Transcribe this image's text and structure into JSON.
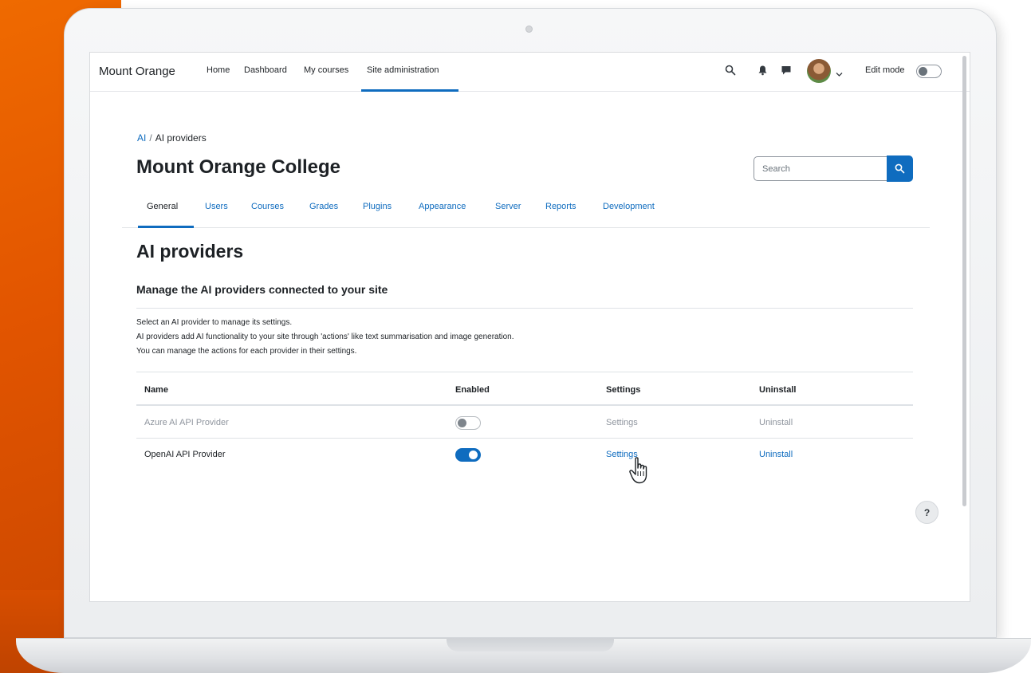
{
  "navbar": {
    "brand": "Mount Orange",
    "items": [
      "Home",
      "Dashboard",
      "My courses",
      "Site administration"
    ],
    "edit_mode_label": "Edit mode"
  },
  "breadcrumb": {
    "root": "AI",
    "separator": "/",
    "current": "AI providers"
  },
  "site_title": "Mount Orange College",
  "search": {
    "placeholder": "Search"
  },
  "tabs": [
    "General",
    "Users",
    "Courses",
    "Grades",
    "Plugins",
    "Appearance",
    "Server",
    "Reports",
    "Development"
  ],
  "page": {
    "heading": "AI providers",
    "subheading": "Manage the AI providers connected to your site",
    "description": [
      "Select an AI provider to manage its settings.",
      "AI providers add AI functionality to your site through 'actions' like text summarisation and image generation.",
      "You can manage the actions for each provider in their settings."
    ]
  },
  "table": {
    "headers": [
      "Name",
      "Enabled",
      "Settings",
      "Uninstall"
    ],
    "rows": [
      {
        "name": "Azure AI API Provider",
        "enabled": false,
        "settings": "Settings",
        "uninstall": "Uninstall"
      },
      {
        "name": "OpenAI API Provider",
        "enabled": true,
        "settings": "Settings",
        "uninstall": "Uninstall"
      }
    ]
  },
  "help_label": "?",
  "colors": {
    "accent": "#0f6cbf",
    "brand_orange": "#e25500",
    "muted": "#8f959e"
  },
  "icons": [
    "search-icon",
    "bell-icon",
    "message-icon",
    "chevron-down-icon",
    "help-icon",
    "hand-cursor-icon"
  ]
}
